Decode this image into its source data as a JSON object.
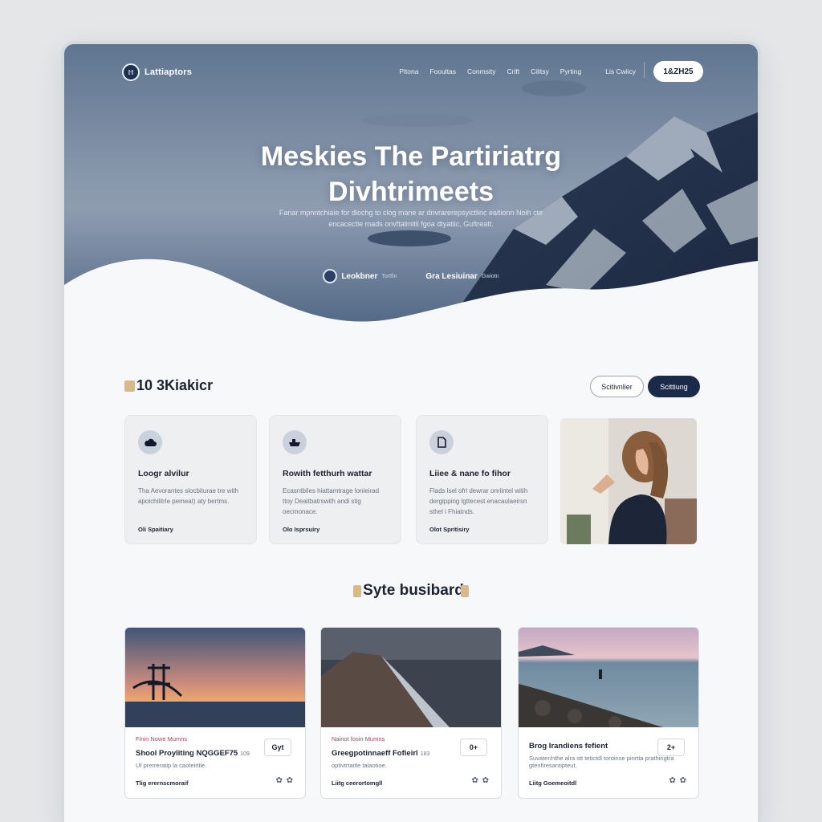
{
  "nav": {
    "brand_logo": "ℍ",
    "brand": "Lattiaptors",
    "links": [
      "Pltona",
      "Fooultas",
      "Conmsity",
      "Crift",
      "Cilitsy",
      "Pyrting",
      "Lis Cwiicy"
    ],
    "cta": "1&ZH25"
  },
  "hero": {
    "title_line1": "Meskies The Partiriatrg",
    "title_line2": "Divhtrimeets",
    "subtitle": "Fanar mpnntchiaie for dlochg to clog mane ar dnvrarerepsyictlinc ealtionn Noih cte encacectie mads onvftalmitil fgoa dtyatiic, Guftreatt.",
    "partners": [
      {
        "name": "Leokbner",
        "tag": "Tortfin"
      },
      {
        "name": "Gra Lesiuinar",
        "tag": "Gwiotn"
      }
    ]
  },
  "section1": {
    "title": "10 3Kiakicr",
    "btn_outline": "Scitivnlier",
    "btn_dark": "Scittiung",
    "cards": [
      {
        "title": "Loogr alvilur",
        "desc": "Tha Aevorantes slocbiturae tre with apoichilitrle pemeat) aty bertms.",
        "link": "Oli Spaitiary"
      },
      {
        "title": "Rowith fetthurh wattar",
        "desc": "Ecasntbiles hiattamtrage lonieirad ttoy Deaitbatrswith andi stig oecmonace.",
        "link": "Olo Isprsuiry"
      },
      {
        "title": "Liiee & nane fo fihor",
        "desc": "Flads lsel ofrl dewrar onriintel witih dergipping lgttecest enacaulaeirsn sthel i Fhiatnds.",
        "link": "Olot Spritisiry"
      }
    ]
  },
  "section2": {
    "title": "Syte busibard",
    "posts": [
      {
        "meta": "Finin Nowe Mumns",
        "title": "Shool Proyliting NQGGEF75",
        "tag": "109",
        "desc": "Uf prerreratip la caoteiritle.",
        "action": "Gyt",
        "link": "Tlig erernscmoraif"
      },
      {
        "meta": "Nainot fosin Mumns",
        "title": "Greegpotinnaeff Fofieirl",
        "tag": "183",
        "desc": "optivtrtaitle talaotioe.",
        "action": "0+",
        "link": "Liitg ceerortomgll"
      },
      {
        "meta": "",
        "title": "Brog Irandiens fefient",
        "tag": "",
        "desc": "Suvater/nthe alra stt tetictdl toroinse pinrtta prathingtra gtenfiresantipteut.",
        "action": "2+",
        "link": "Liitg Goemeoitdl"
      }
    ]
  }
}
